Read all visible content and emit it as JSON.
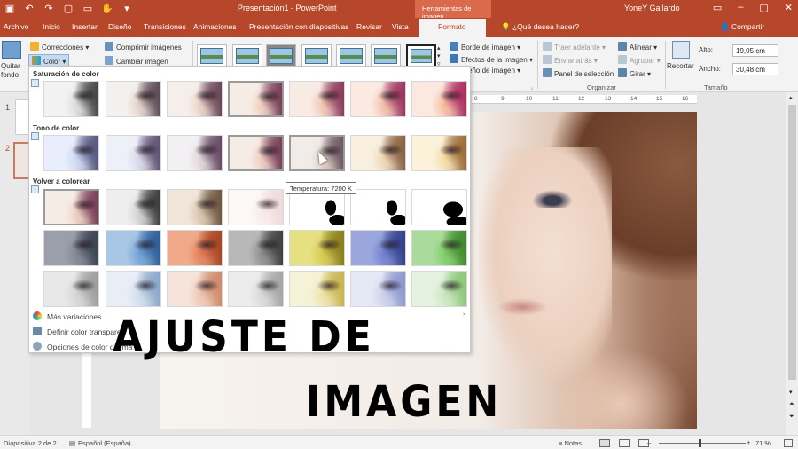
{
  "window": {
    "title": "Presentación1 - PowerPoint",
    "context_tab_group": "Herramientas de imagen",
    "user": "YoneY Gallardo"
  },
  "colors": {
    "accent": "#b7472a",
    "ribbon_bg": "#f3f3f3",
    "workspace_bg": "#e6e6e6"
  },
  "tabs": [
    {
      "label": "Archivo"
    },
    {
      "label": "Inicio"
    },
    {
      "label": "Insertar"
    },
    {
      "label": "Diseño"
    },
    {
      "label": "Transiciones"
    },
    {
      "label": "Animaciones"
    },
    {
      "label": "Presentación con diapositivas"
    },
    {
      "label": "Revisar"
    },
    {
      "label": "Vista"
    },
    {
      "label": "Formato"
    }
  ],
  "tell_me": "¿Qué desea hacer?",
  "share": "Compartir",
  "ribbon": {
    "quitar_fondo": "Quitar fondo",
    "correcciones": "Correcciones",
    "color": "Color",
    "comprimir": "Comprimir imágenes",
    "cambiar": "Cambiar imagen",
    "borde": "Borde de imagen",
    "efectos": "Efectos de la imagen",
    "diseno_imagen": "eño de imagen",
    "traer": "Traer adelante",
    "enviar": "Enviar atrás",
    "panel": "Panel de selección",
    "alinear": "Alinear",
    "agrupar": "Agrupar",
    "girar": "Girar",
    "organizar": "Organizar",
    "recortar": "Recortar",
    "alto_label": "Alto:",
    "alto_value": "19,05 cm",
    "ancho_label": "Ancho:",
    "ancho_value": "30,48 cm",
    "tamano": "Tamaño"
  },
  "dropdown": {
    "saturacion": "Saturación de color",
    "tono": "Tono de color",
    "volver": "Volver a colorear",
    "tooltip": "Temperatura: 7200 K",
    "mas": "Más variaciones",
    "definir": "Definir color transparen",
    "opciones": "Opciones de color de ima"
  },
  "slides": [
    {
      "number": "1"
    },
    {
      "number": "2"
    }
  ],
  "overlay": {
    "line1": "AJUSTE DE",
    "line2": "IMAGEN"
  },
  "ruler_marks": [
    "8",
    "9",
    "10",
    "11",
    "12",
    "13",
    "14",
    "15",
    "16"
  ],
  "status": {
    "slide_info": "Diapositiva 2 de 2",
    "language": "Español (España)",
    "notes": "Notas",
    "zoom": "71 %"
  }
}
